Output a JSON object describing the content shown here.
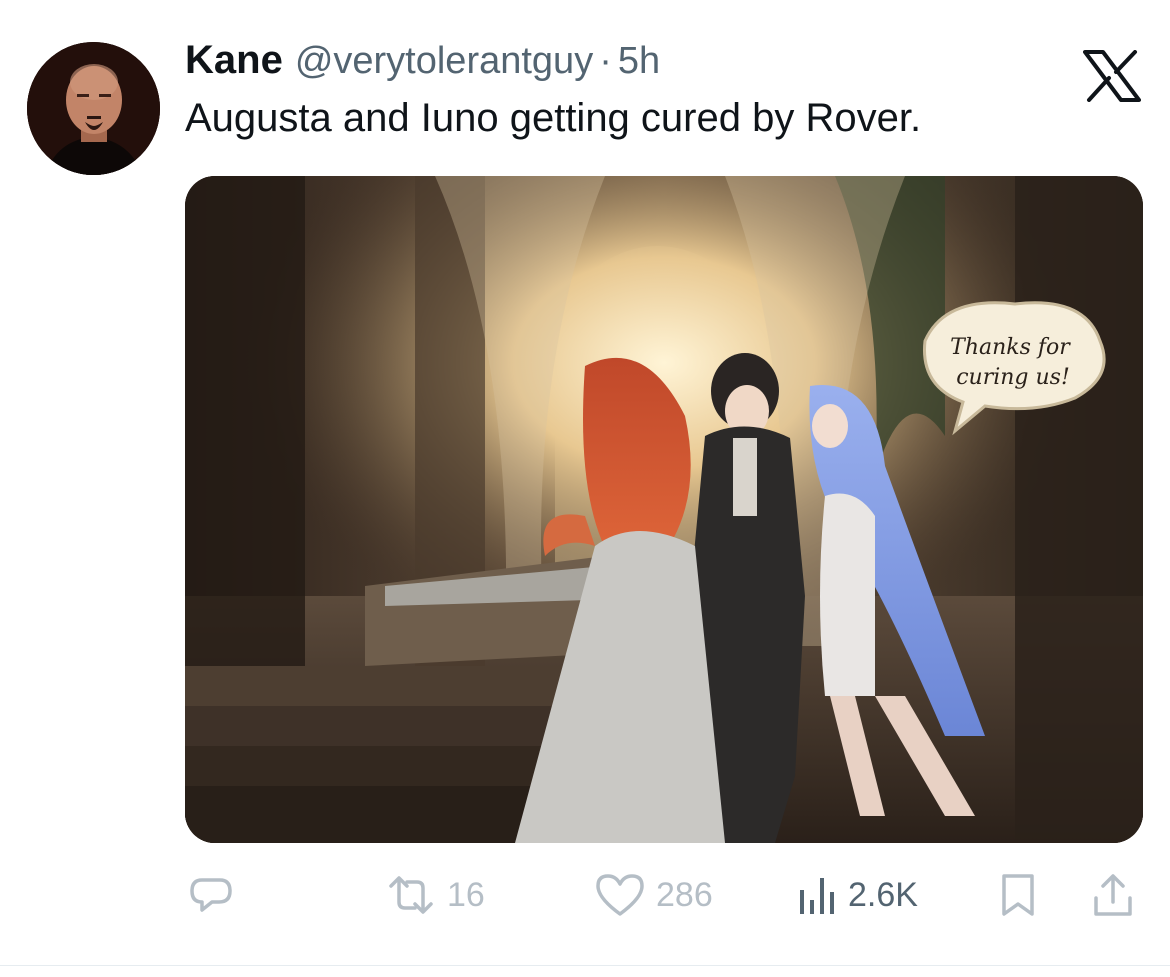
{
  "author": {
    "name": "Kane",
    "handle": "@verytolerantguy",
    "separator": "·",
    "time": "5h"
  },
  "tweet": {
    "text": "Augusta and Iuno getting cured by Rover."
  },
  "media": {
    "speech_bubble": {
      "line1": "Thanks for",
      "line2": "curing us!"
    }
  },
  "actions": {
    "reply": {
      "icon": "reply-icon"
    },
    "retweet": {
      "icon": "retweet-icon",
      "count": "16"
    },
    "like": {
      "icon": "heart-icon",
      "count": "286"
    },
    "views": {
      "icon": "views-icon",
      "count": "2.6K"
    },
    "bookmark": {
      "icon": "bookmark-icon"
    },
    "share": {
      "icon": "share-icon"
    }
  },
  "colors": {
    "text": "#0f1419",
    "secondary": "#536471",
    "muted_action": "#b5bec6"
  }
}
